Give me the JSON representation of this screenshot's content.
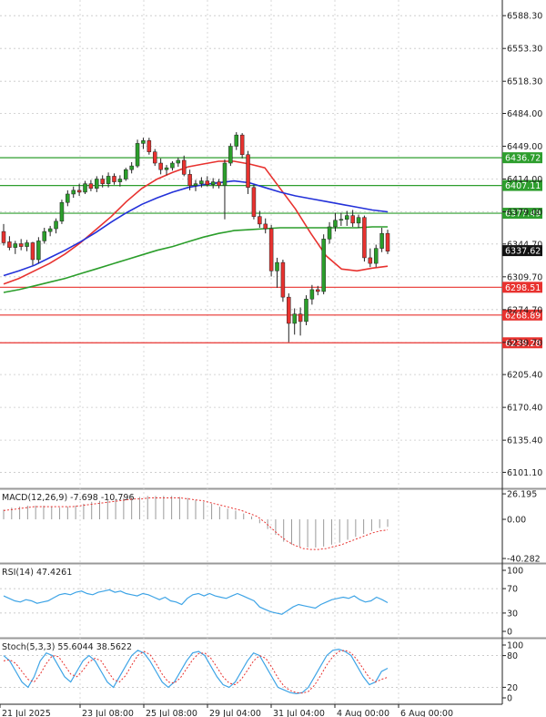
{
  "chart_data": [
    {
      "type": "candlestick",
      "ylim": [
        6085,
        6605
      ],
      "y_ticks": [
        "6588.30",
        "6553.30",
        "6518.30",
        "6484.00",
        "6449.00",
        "6414.00",
        "6379.00",
        "6344.70",
        "6309.70",
        "6274.70",
        "6239.70",
        "6205.40",
        "6170.40",
        "6135.40",
        "6101.10"
      ],
      "horizontal_levels": [
        {
          "label": "6436.72",
          "value": 6436.72,
          "color": "#2e9e2e"
        },
        {
          "label": "6407.11",
          "value": 6407.11,
          "color": "#2e9e2e"
        },
        {
          "label": "6377.49",
          "value": 6377.49,
          "color": "#2e9e2e"
        },
        {
          "label": "6298.51",
          "value": 6298.51,
          "color": "#e8322f"
        },
        {
          "label": "6268.89",
          "value": 6268.89,
          "color": "#e8322f"
        },
        {
          "label": "6239.28",
          "value": 6239.28,
          "color": "#e8322f"
        }
      ],
      "current_price": {
        "label": "6337.62",
        "value": 6337.62
      },
      "candles": [
        {
          "o": 6358,
          "h": 6366,
          "l": 6343,
          "c": 6346
        },
        {
          "o": 6347,
          "h": 6353,
          "l": 6338,
          "c": 6341
        },
        {
          "o": 6341,
          "h": 6348,
          "l": 6334,
          "c": 6345
        },
        {
          "o": 6345,
          "h": 6350,
          "l": 6338,
          "c": 6342
        },
        {
          "o": 6342,
          "h": 6349,
          "l": 6337,
          "c": 6346
        },
        {
          "o": 6346,
          "h": 6347,
          "l": 6322,
          "c": 6328
        },
        {
          "o": 6328,
          "h": 6352,
          "l": 6324,
          "c": 6348
        },
        {
          "o": 6348,
          "h": 6362,
          "l": 6345,
          "c": 6358
        },
        {
          "o": 6358,
          "h": 6364,
          "l": 6353,
          "c": 6361
        },
        {
          "o": 6361,
          "h": 6372,
          "l": 6356,
          "c": 6369
        },
        {
          "o": 6369,
          "h": 6392,
          "l": 6366,
          "c": 6389
        },
        {
          "o": 6389,
          "h": 6402,
          "l": 6385,
          "c": 6398
        },
        {
          "o": 6398,
          "h": 6406,
          "l": 6394,
          "c": 6402
        },
        {
          "o": 6402,
          "h": 6409,
          "l": 6396,
          "c": 6400
        },
        {
          "o": 6400,
          "h": 6412,
          "l": 6398,
          "c": 6409
        },
        {
          "o": 6409,
          "h": 6413,
          "l": 6401,
          "c": 6404
        },
        {
          "o": 6404,
          "h": 6417,
          "l": 6400,
          "c": 6414
        },
        {
          "o": 6414,
          "h": 6418,
          "l": 6405,
          "c": 6409
        },
        {
          "o": 6409,
          "h": 6421,
          "l": 6405,
          "c": 6417
        },
        {
          "o": 6417,
          "h": 6420,
          "l": 6408,
          "c": 6411
        },
        {
          "o": 6411,
          "h": 6418,
          "l": 6406,
          "c": 6414
        },
        {
          "o": 6414,
          "h": 6426,
          "l": 6412,
          "c": 6424
        },
        {
          "o": 6424,
          "h": 6432,
          "l": 6420,
          "c": 6428
        },
        {
          "o": 6428,
          "h": 6456,
          "l": 6426,
          "c": 6452
        },
        {
          "o": 6452,
          "h": 6458,
          "l": 6446,
          "c": 6455
        },
        {
          "o": 6455,
          "h": 6458,
          "l": 6440,
          "c": 6443
        },
        {
          "o": 6443,
          "h": 6446,
          "l": 6428,
          "c": 6431
        },
        {
          "o": 6431,
          "h": 6436,
          "l": 6419,
          "c": 6424
        },
        {
          "o": 6424,
          "h": 6429,
          "l": 6418,
          "c": 6426
        },
        {
          "o": 6426,
          "h": 6433,
          "l": 6423,
          "c": 6431
        },
        {
          "o": 6431,
          "h": 6437,
          "l": 6427,
          "c": 6434
        },
        {
          "o": 6434,
          "h": 6439,
          "l": 6417,
          "c": 6419
        },
        {
          "o": 6419,
          "h": 6424,
          "l": 6402,
          "c": 6407
        },
        {
          "o": 6407,
          "h": 6413,
          "l": 6401,
          "c": 6409
        },
        {
          "o": 6409,
          "h": 6416,
          "l": 6405,
          "c": 6412
        },
        {
          "o": 6412,
          "h": 6417,
          "l": 6406,
          "c": 6408
        },
        {
          "o": 6408,
          "h": 6415,
          "l": 6404,
          "c": 6411
        },
        {
          "o": 6411,
          "h": 6414,
          "l": 6404,
          "c": 6407
        },
        {
          "o": 6407,
          "h": 6435,
          "l": 6371,
          "c": 6431
        },
        {
          "o": 6431,
          "h": 6452,
          "l": 6428,
          "c": 6449
        },
        {
          "o": 6449,
          "h": 6464,
          "l": 6445,
          "c": 6461
        },
        {
          "o": 6461,
          "h": 6463,
          "l": 6436,
          "c": 6440
        },
        {
          "o": 6440,
          "h": 6444,
          "l": 6398,
          "c": 6405
        },
        {
          "o": 6405,
          "h": 6408,
          "l": 6371,
          "c": 6374
        },
        {
          "o": 6374,
          "h": 6380,
          "l": 6362,
          "c": 6366
        },
        {
          "o": 6366,
          "h": 6372,
          "l": 6356,
          "c": 6361
        },
        {
          "o": 6361,
          "h": 6365,
          "l": 6310,
          "c": 6316
        },
        {
          "o": 6316,
          "h": 6330,
          "l": 6298,
          "c": 6325
        },
        {
          "o": 6325,
          "h": 6328,
          "l": 6283,
          "c": 6288
        },
        {
          "o": 6288,
          "h": 6292,
          "l": 6240,
          "c": 6260
        },
        {
          "o": 6260,
          "h": 6276,
          "l": 6248,
          "c": 6270
        },
        {
          "o": 6270,
          "h": 6277,
          "l": 6247,
          "c": 6262
        },
        {
          "o": 6262,
          "h": 6290,
          "l": 6258,
          "c": 6286
        },
        {
          "o": 6286,
          "h": 6301,
          "l": 6280,
          "c": 6296
        },
        {
          "o": 6296,
          "h": 6300,
          "l": 6290,
          "c": 6294
        },
        {
          "o": 6294,
          "h": 6355,
          "l": 6291,
          "c": 6350
        },
        {
          "o": 6350,
          "h": 6368,
          "l": 6345,
          "c": 6363
        },
        {
          "o": 6363,
          "h": 6378,
          "l": 6358,
          "c": 6370
        },
        {
          "o": 6370,
          "h": 6378,
          "l": 6364,
          "c": 6371
        },
        {
          "o": 6371,
          "h": 6380,
          "l": 6364,
          "c": 6375
        },
        {
          "o": 6375,
          "h": 6381,
          "l": 6363,
          "c": 6367
        },
        {
          "o": 6367,
          "h": 6376,
          "l": 6362,
          "c": 6373
        },
        {
          "o": 6373,
          "h": 6375,
          "l": 6326,
          "c": 6330
        },
        {
          "o": 6330,
          "h": 6340,
          "l": 6320,
          "c": 6324
        },
        {
          "o": 6324,
          "h": 6344,
          "l": 6320,
          "c": 6340
        },
        {
          "o": 6340,
          "h": 6362,
          "l": 6336,
          "c": 6356
        },
        {
          "o": 6356,
          "h": 6360,
          "l": 6334,
          "c": 6337
        }
      ],
      "moving_averages": [
        {
          "color": "#e8322f",
          "points": [
            6302,
            6308,
            6316,
            6324,
            6334,
            6346,
            6360,
            6374,
            6390,
            6404,
            6414,
            6421,
            6427,
            6430,
            6433,
            6433,
            6430,
            6426,
            6404,
            6382,
            6356,
            6332,
            6318,
            6316,
            6319,
            6321
          ]
        },
        {
          "color": "#2331d9",
          "points": [
            6311,
            6316,
            6322,
            6330,
            6338,
            6347,
            6357,
            6368,
            6378,
            6387,
            6394,
            6400,
            6405,
            6408,
            6410,
            6412,
            6410,
            6405,
            6400,
            6396,
            6393,
            6390,
            6387,
            6384,
            6381,
            6379
          ]
        },
        {
          "color": "#2b9e2b",
          "points": [
            6293,
            6296,
            6300,
            6304,
            6308,
            6313,
            6318,
            6323,
            6328,
            6333,
            6338,
            6342,
            6347,
            6352,
            6356,
            6359,
            6360,
            6361,
            6362,
            6362,
            6362,
            6362,
            6362,
            6362,
            6363,
            6363
          ]
        }
      ]
    },
    {
      "type": "bar",
      "label": "MACD(12,26,9) -7.698 -10.796",
      "ylim": [
        -44,
        30
      ],
      "y_ticks": [
        "26.195",
        "0.00",
        "-40.282"
      ],
      "hist": [
        10,
        12,
        13,
        14,
        14,
        14,
        13,
        12,
        13,
        14,
        16,
        18,
        19,
        20,
        21,
        22,
        23,
        23,
        24,
        24,
        24,
        24,
        23,
        22,
        20,
        18,
        16,
        13,
        11,
        9,
        6,
        3,
        -4,
        -10,
        -16,
        -23,
        -26,
        -28,
        -29,
        -29,
        -28,
        -26,
        -24,
        -21,
        -18,
        -15,
        -12,
        -9,
        -7.7
      ],
      "signal": [
        9,
        10,
        11,
        12,
        13,
        13,
        13,
        13,
        13,
        13,
        14,
        15,
        16,
        17,
        18,
        19,
        20,
        21,
        21,
        22,
        22,
        22,
        22,
        22,
        21,
        20,
        19,
        17,
        15,
        13,
        11,
        9,
        6,
        3,
        -3,
        -10,
        -17,
        -23,
        -27,
        -30,
        -31,
        -31,
        -30,
        -28,
        -26,
        -23,
        -20,
        -17,
        -14,
        -12,
        -10.8
      ]
    },
    {
      "type": "line",
      "label": "RSI(14) 47.4261",
      "ylim": [
        0,
        100
      ],
      "y_ticks": [
        "100",
        "70",
        "30",
        "0"
      ],
      "rsi": [
        58,
        54,
        50,
        48,
        52,
        50,
        46,
        48,
        50,
        55,
        60,
        62,
        60,
        64,
        66,
        62,
        60,
        64,
        66,
        68,
        64,
        66,
        62,
        60,
        58,
        62,
        60,
        56,
        52,
        56,
        50,
        48,
        44,
        54,
        60,
        62,
        58,
        62,
        58,
        56,
        54,
        58,
        62,
        58,
        54,
        50,
        40,
        36,
        32,
        30,
        28,
        34,
        40,
        44,
        42,
        40,
        38,
        44,
        48,
        52,
        54,
        56,
        54,
        58,
        52,
        48,
        50,
        56,
        52,
        47
      ]
    },
    {
      "type": "line",
      "label": "Stoch(5,3,3) 55.6044 38.5622",
      "ylim": [
        0,
        100
      ],
      "y_ticks": [
        "100",
        "80",
        "20",
        "0"
      ],
      "k": [
        80,
        70,
        50,
        30,
        20,
        40,
        70,
        85,
        80,
        60,
        40,
        30,
        50,
        70,
        80,
        70,
        50,
        30,
        20,
        40,
        60,
        80,
        90,
        85,
        70,
        50,
        30,
        20,
        30,
        50,
        70,
        85,
        88,
        80,
        60,
        40,
        25,
        20,
        30,
        50,
        70,
        85,
        80,
        60,
        40,
        20,
        15,
        10,
        8,
        10,
        20,
        40,
        60,
        80,
        90,
        92,
        88,
        80,
        60,
        40,
        25,
        30,
        50,
        56
      ],
      "d": [
        70,
        72,
        65,
        50,
        35,
        30,
        45,
        65,
        80,
        78,
        62,
        45,
        40,
        52,
        68,
        75,
        70,
        52,
        35,
        30,
        42,
        62,
        80,
        88,
        82,
        65,
        45,
        30,
        28,
        38,
        55,
        72,
        84,
        85,
        75,
        58,
        40,
        28,
        25,
        35,
        52,
        70,
        80,
        75,
        58,
        38,
        22,
        14,
        10,
        9,
        12,
        24,
        42,
        62,
        78,
        88,
        90,
        85,
        72,
        55,
        38,
        30,
        35,
        39
      ]
    }
  ],
  "x_labels": [
    "21 Jul 2025",
    "23 Jul 08:00",
    "25 Jul 08:00",
    "29 Jul 04:00",
    "31 Jul 04:00",
    "4 Aug 00:00",
    "6 Aug 00:00"
  ]
}
